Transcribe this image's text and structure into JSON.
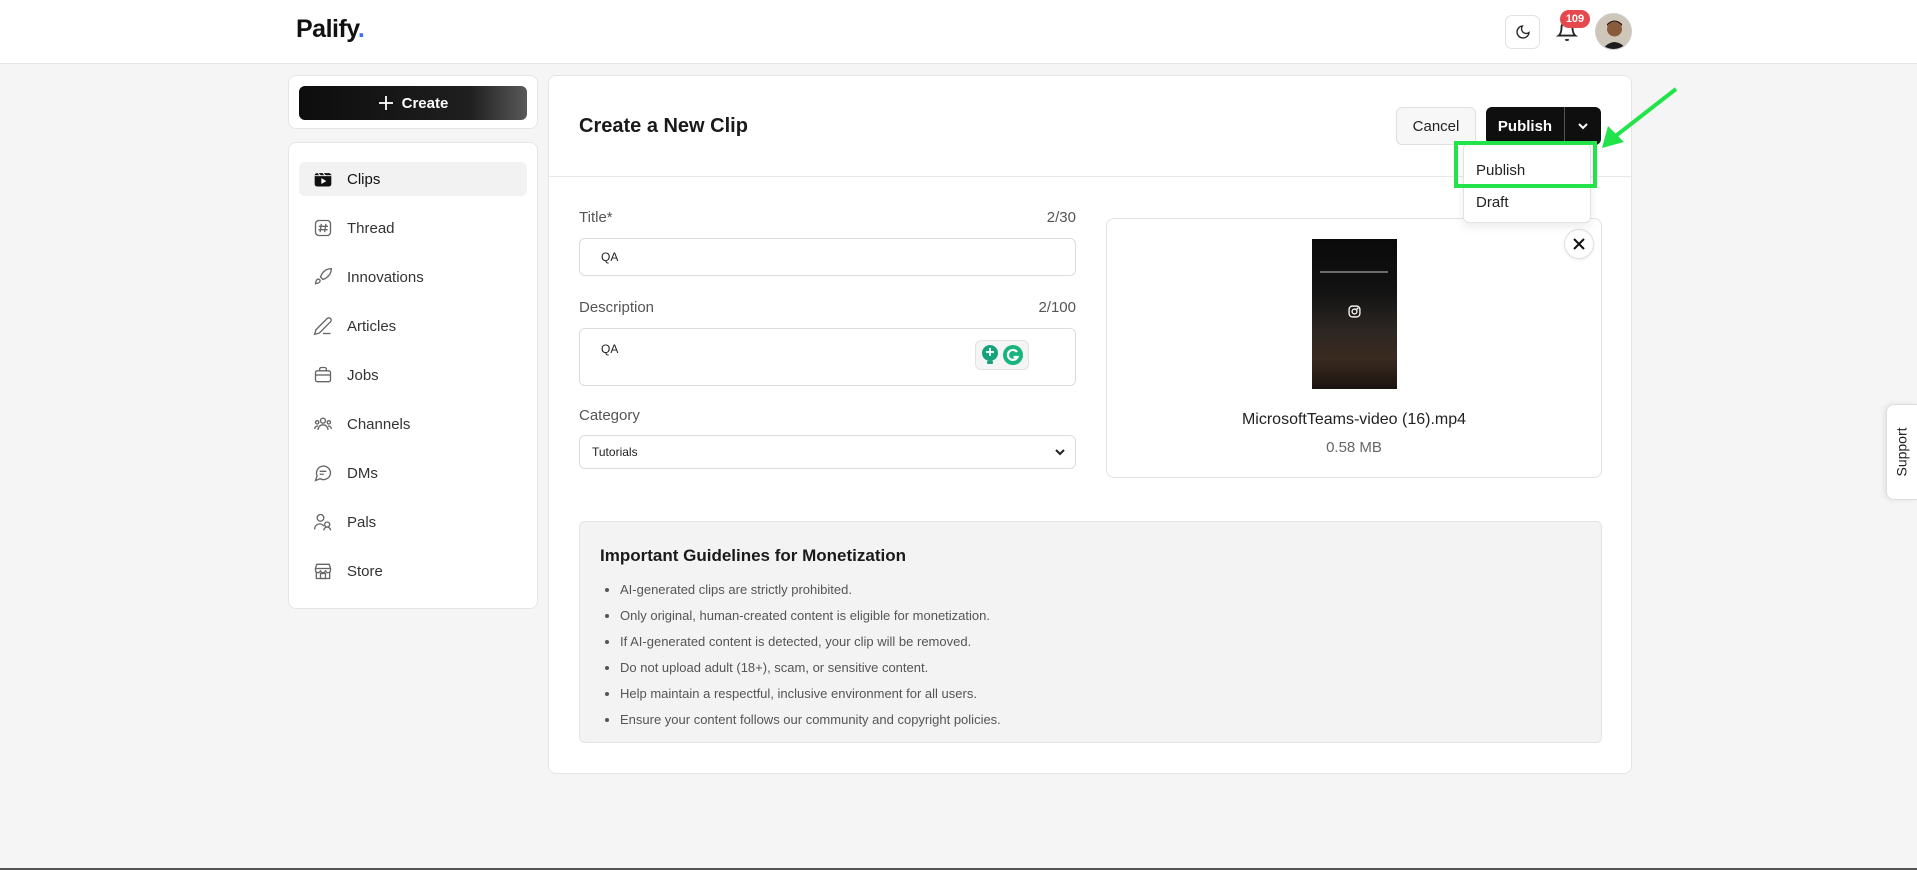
{
  "app": {
    "logo_text": "Palify",
    "logo_dot": ".",
    "accent": "#3b6cf6"
  },
  "header": {
    "notification_count": "109",
    "theme_icon": "moon-icon",
    "bell_icon": "bell-icon"
  },
  "sidebar": {
    "create_label": "Create",
    "items": [
      {
        "label": "Clips",
        "icon": "clapperboard-icon",
        "active": true
      },
      {
        "label": "Thread",
        "icon": "hash-icon"
      },
      {
        "label": "Innovations",
        "icon": "rocket-icon"
      },
      {
        "label": "Articles",
        "icon": "pen-icon"
      },
      {
        "label": "Jobs",
        "icon": "briefcase-icon"
      },
      {
        "label": "Channels",
        "icon": "users-group-icon"
      },
      {
        "label": "DMs",
        "icon": "chat-bubble-icon"
      },
      {
        "label": "Pals",
        "icon": "users-icon"
      },
      {
        "label": "Store",
        "icon": "store-icon"
      }
    ]
  },
  "main": {
    "title": "Create a New Clip",
    "cancel_label": "Cancel",
    "publish_label": "Publish",
    "dropdown": {
      "items": [
        "Publish",
        "Draft"
      ]
    },
    "form": {
      "title_label": "Title*",
      "title_count": "2/30",
      "title_value": "QA",
      "description_label": "Description",
      "description_count": "2/100",
      "description_value": "QA",
      "category_label": "Category",
      "category_value": "Tutorials"
    },
    "media": {
      "file_name": "MicrosoftTeams-video (16).mp4",
      "file_size": "0.58 MB"
    },
    "guidelines": {
      "title": "Important Guidelines for Monetization",
      "items": [
        "AI-generated clips are strictly prohibited.",
        "Only original, human-created content is eligible for monetization.",
        "If AI-generated content is detected, your clip will be removed.",
        "Do not upload adult (18+), scam, or sensitive content.",
        "Help maintain a respectful, inclusive environment for all users.",
        "Ensure your content follows our community and copyright policies."
      ]
    }
  },
  "support_label": "Support",
  "annotation_color": "#22e34a"
}
